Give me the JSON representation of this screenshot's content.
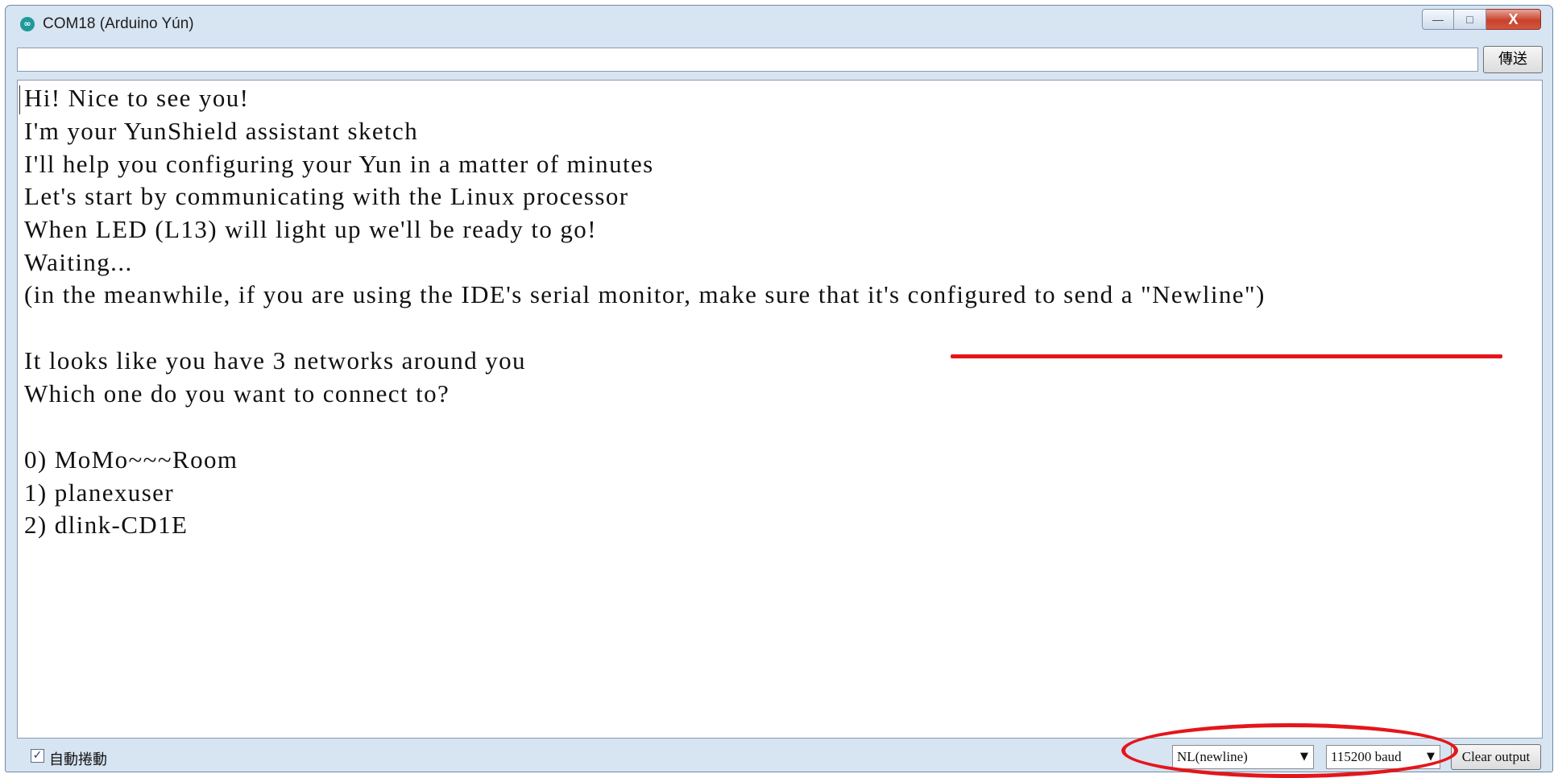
{
  "window": {
    "title": "COM18 (Arduino Yún)",
    "app_icon": "arduino-logo-icon",
    "app_icon_glyph": "∞",
    "controls": {
      "minimize": "—",
      "maximize": "□",
      "close": "X"
    }
  },
  "send": {
    "input_value": "",
    "button_label": "傳送"
  },
  "output": {
    "lines": [
      "Hi! Nice to see you!",
      "I'm your YunShield assistant sketch",
      "I'll help you configuring your Yun in a matter of minutes",
      "Let's start by communicating with the Linux processor",
      "When LED (L13) will light up we'll be ready to go!",
      "Waiting...",
      "(in the meanwhile, if you are using the IDE's serial monitor, make sure that it's configured to send a \"Newline\")",
      "",
      "It looks like you have 3 networks around you",
      "Which one do you want to connect to?",
      "",
      "0) MoMo~~~Room",
      "1) planexuser",
      "2) dlink-CD1E"
    ]
  },
  "footer": {
    "autoscroll_checked": true,
    "autoscroll_mark": "✓",
    "autoscroll_label": "自動捲動",
    "line_ending": "NL(newline)",
    "baud_rate": "115200 baud",
    "dropdown_arrow": "▼",
    "clear_label": "Clear output"
  },
  "annotations": {
    "color": "#e4161b"
  }
}
